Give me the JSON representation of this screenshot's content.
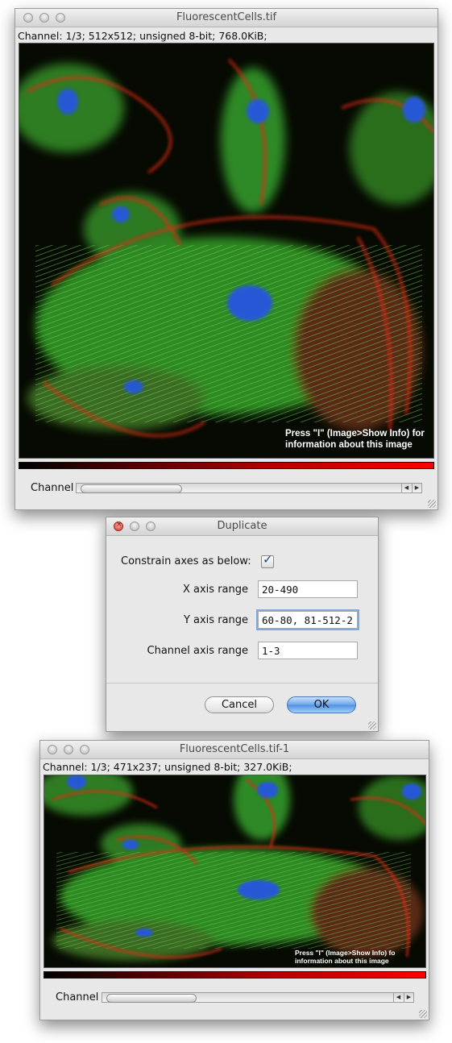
{
  "window1": {
    "title": "FluorescentCells.tif",
    "info": "Channel: 1/3; 512x512; unsigned 8-bit; 768.0KiB;",
    "overlay_line1": "Press \"I\" (Image>Show Info) for",
    "overlay_line2": "information about this image",
    "slider_label": "Channel",
    "lut_color": "#ff0000"
  },
  "dialog": {
    "title": "Duplicate",
    "constrain_label": "Constrain axes as below:",
    "constrain_checked": true,
    "fields": [
      {
        "label": "X axis range",
        "value": "20-490"
      },
      {
        "label": "Y axis range",
        "value": "60-80, 81-512-2"
      },
      {
        "label": "Channel axis range",
        "value": "1-3"
      }
    ],
    "cancel_label": "Cancel",
    "ok_label": "OK"
  },
  "window2": {
    "title": "FluorescentCells.tif-1",
    "info": "Channel: 1/3; 471x237; unsigned 8-bit; 327.0KiB;",
    "overlay_line1": "Press \"I\" (Image>Show Info) fo",
    "overlay_line2": "information about this image",
    "slider_label": "Channel"
  }
}
